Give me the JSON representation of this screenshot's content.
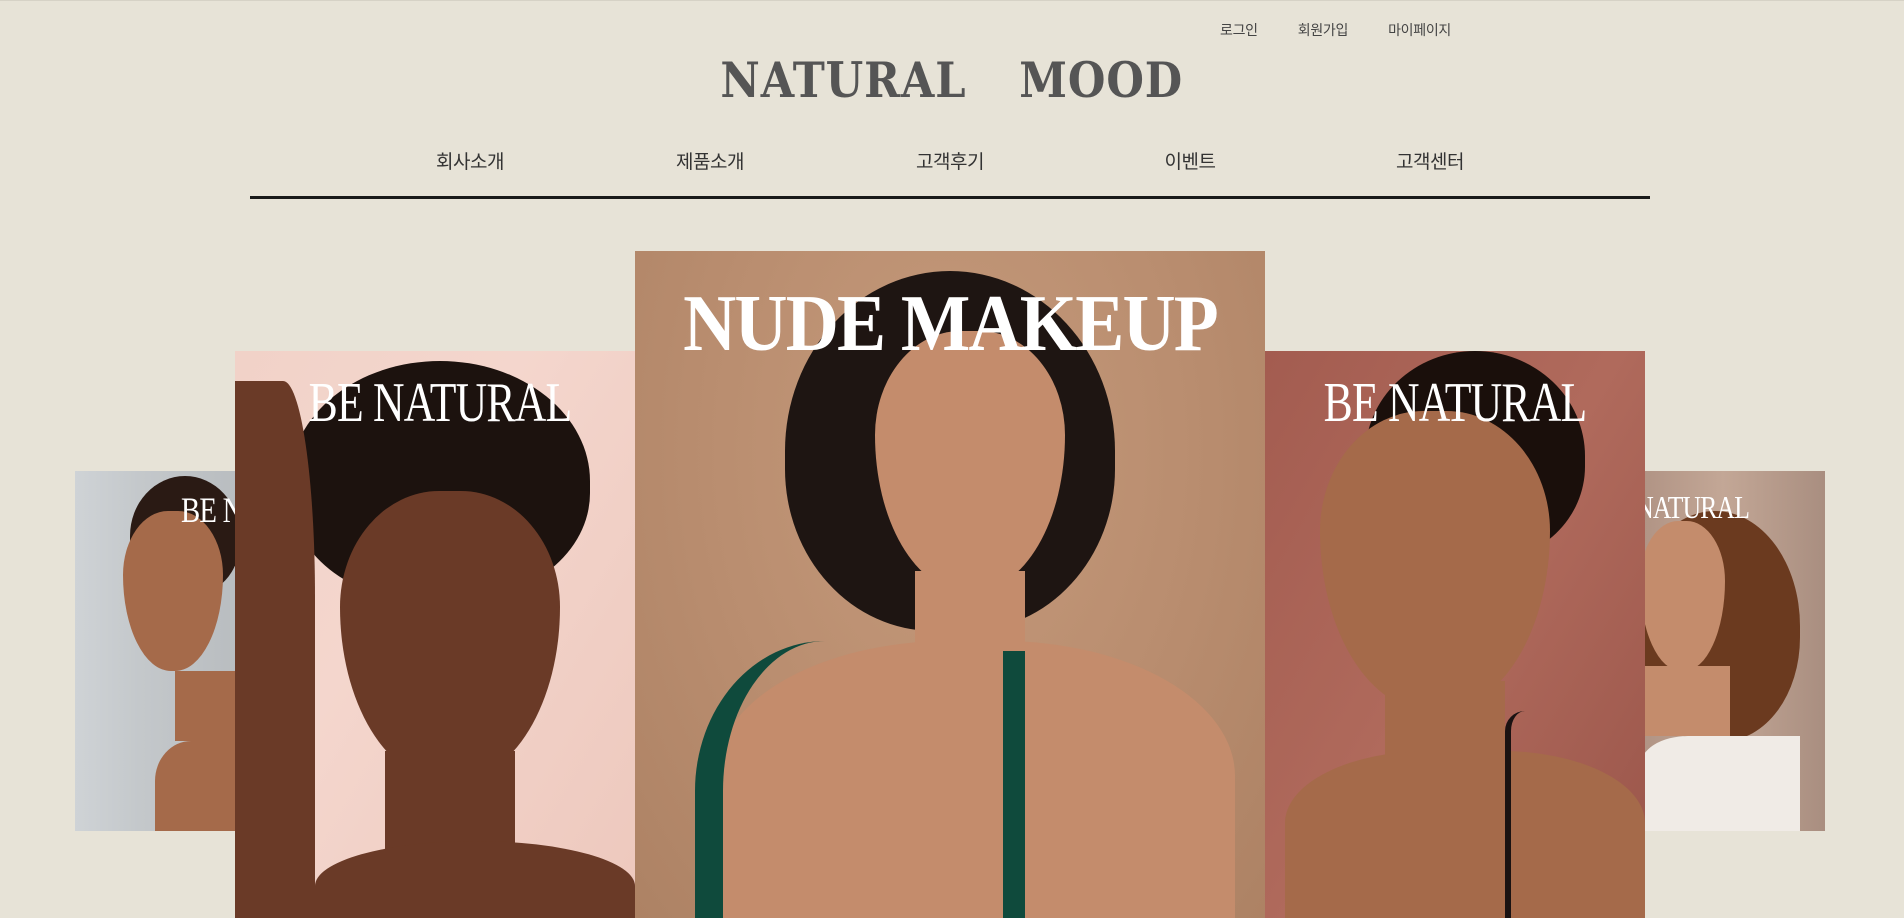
{
  "util_nav": {
    "login": "로그인",
    "signup": "회원가입",
    "mypage": "마이페이지"
  },
  "logo": "NATURAL  MOOD",
  "main_nav": [
    "회사소개",
    "제품소개",
    "고객후기",
    "이벤트",
    "고객센터"
  ],
  "slides": [
    {
      "caption": "BE NATURAL",
      "bg": "#c8cccf"
    },
    {
      "caption": "BE NATURAL",
      "bg": "#f2d4ca"
    },
    {
      "caption": "NUDE MAKEUP",
      "bg": "#bb8f71"
    },
    {
      "caption": "BE NATURAL",
      "bg": "#a8605"
    },
    {
      "caption": "BE NATURAL",
      "bg": "#b89b8c"
    }
  ],
  "colors": {
    "background": "#e7e3d7",
    "logo": "#555555",
    "nav_rule": "#1a1a1a"
  }
}
